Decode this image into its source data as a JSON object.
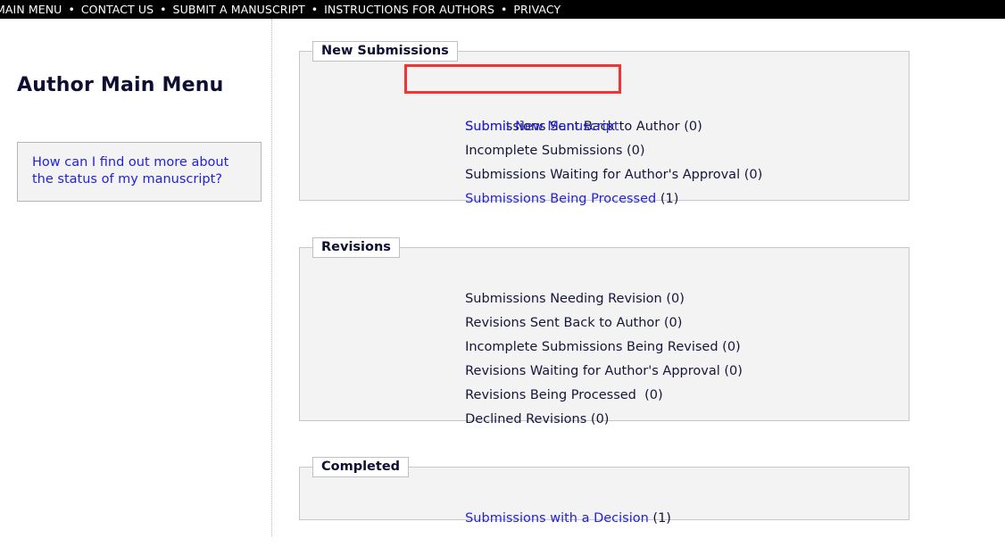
{
  "navbar": {
    "items": [
      {
        "label": "MAIN MENU"
      },
      {
        "label": "CONTACT US"
      },
      {
        "label": "SUBMIT A MANUSCRIPT"
      },
      {
        "label": "INSTRUCTIONS FOR AUTHORS"
      },
      {
        "label": "PRIVACY"
      }
    ],
    "separator": "•",
    "background": "#000000",
    "text_color": "#ffffff"
  },
  "sidebar": {
    "title": "Author Main Menu",
    "help_link": "How can I find out more about the status of my manuscript?"
  },
  "colors": {
    "link": "#2222dd",
    "text": "#15153a",
    "highlight_border": "#f43333",
    "panel_background": "#f3f3f3",
    "panel_border": "#c7c7c7"
  },
  "panels": [
    {
      "legend": "New Submissions",
      "rows": [
        {
          "label": "Submit New Manuscript",
          "count": "",
          "is_link": true,
          "highlighted": true
        },
        {
          "label": "Submissions Sent Back to Author",
          "count": " (0)",
          "is_link": false,
          "highlighted": false
        },
        {
          "label": "Incomplete Submissions",
          "count": " (0)",
          "is_link": false,
          "highlighted": false
        },
        {
          "label": "Submissions Waiting for Author's Approval",
          "count": " (0)",
          "is_link": false,
          "highlighted": false
        },
        {
          "label": "Submissions Being Processed",
          "count": " (1)",
          "is_link": true,
          "highlighted": false
        }
      ]
    },
    {
      "legend": "Revisions",
      "rows": [
        {
          "label": "Submissions Needing Revision",
          "count": " (0)",
          "is_link": false,
          "highlighted": false
        },
        {
          "label": "Revisions Sent Back to Author",
          "count": " (0)",
          "is_link": false,
          "highlighted": false
        },
        {
          "label": "Incomplete Submissions Being Revised",
          "count": " (0)",
          "is_link": false,
          "highlighted": false
        },
        {
          "label": "Revisions Waiting for Author's Approval",
          "count": " (0)",
          "is_link": false,
          "highlighted": false
        },
        {
          "label": "Revisions Being Processed",
          "count": "  (0)",
          "is_link": false,
          "highlighted": false
        },
        {
          "label": "Declined Revisions",
          "count": " (0)",
          "is_link": false,
          "highlighted": false
        }
      ]
    },
    {
      "legend": "Completed",
      "rows": [
        {
          "label": "Submissions with a Decision",
          "count": " (1)",
          "is_link": true,
          "highlighted": false
        }
      ]
    }
  ]
}
